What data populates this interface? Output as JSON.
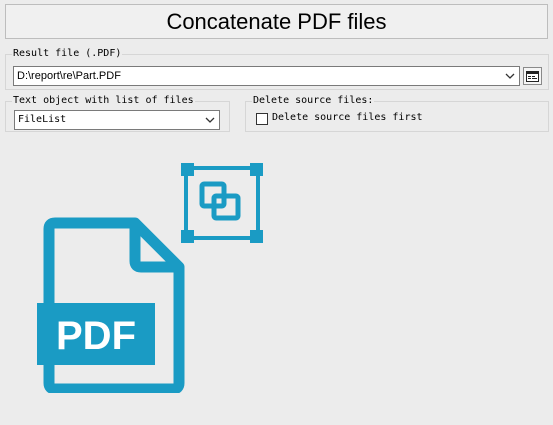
{
  "header": {
    "title": "Concatenate PDF files"
  },
  "result_file": {
    "label": "Result file (.PDF)",
    "value": "D:\\report\\re\\Part.PDF",
    "browse_icon": "browse-icon"
  },
  "text_object": {
    "label": "Text object with list of files",
    "value": "FileList"
  },
  "delete_source": {
    "label": "Delete source files:",
    "checkbox_label": "Delete source files first",
    "checked": false
  },
  "illustration": {
    "pdf_icon": "pdf-file-icon",
    "pdf_text": "PDF",
    "concat_icon": "concatenate-icon",
    "color": "#1a9bc4"
  }
}
